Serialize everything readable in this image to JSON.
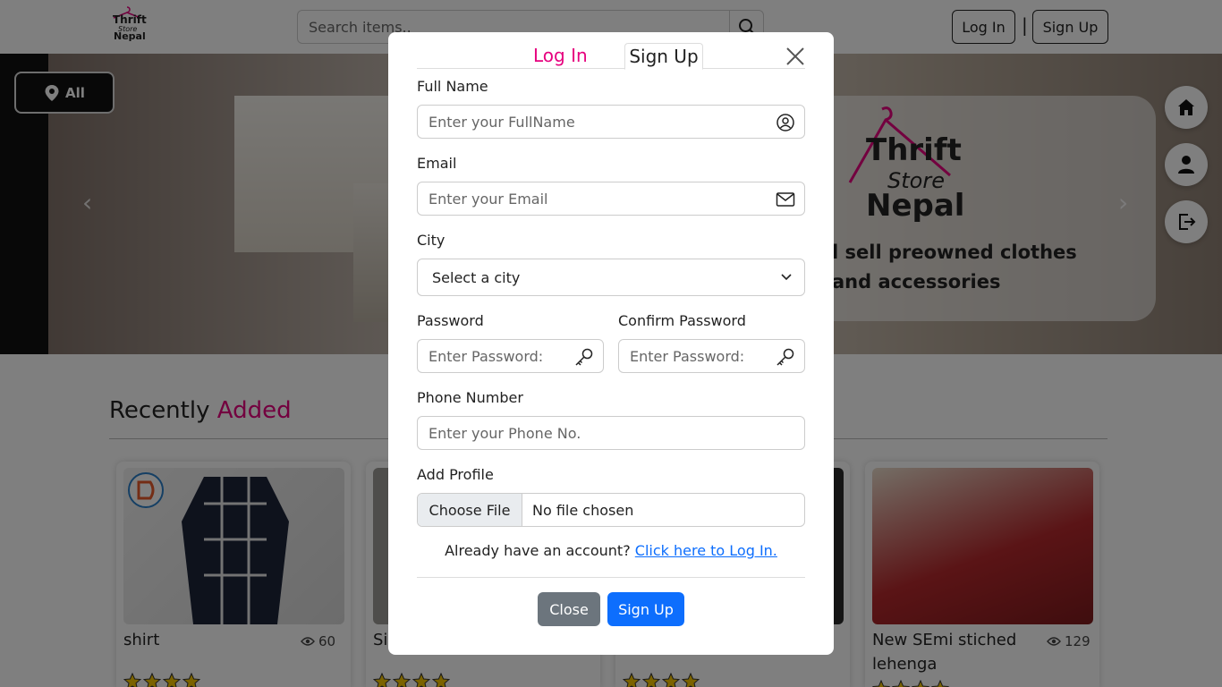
{
  "header": {
    "logo": {
      "line1": "Thrift",
      "line2": "Store",
      "line3": "Nepal"
    },
    "search_placeholder": "Search items..",
    "login_label": "Log In",
    "separator": "|",
    "signup_label": "Sign Up"
  },
  "hero": {
    "location_label": "All",
    "brand_line1": "Thrift",
    "brand_line2": "Store",
    "brand_line3": "Nepal",
    "tagline_line1": "l sell preowned clothes",
    "tagline_line2": "and accessories"
  },
  "recent": {
    "title_plain": "Recently",
    "title_accent": "Added",
    "products": [
      {
        "name": "shirt",
        "views": "60"
      },
      {
        "name": "Si"
      },
      {
        "name": ""
      },
      {
        "name": "New SEmi stiched lehenga",
        "views": "129"
      }
    ]
  },
  "modal": {
    "tab_login": "Log In",
    "tab_signup": "Sign Up",
    "fullname_label": "Full Name",
    "fullname_placeholder": "Enter your FullName",
    "email_label": "Email",
    "email_placeholder": "Enter your Email",
    "city_label": "City",
    "city_value": "Select a city",
    "password_label": "Password",
    "password_placeholder": "Enter Password:",
    "confirm_label": "Confirm Password",
    "confirm_placeholder": "Enter Password:",
    "phone_label": "Phone Number",
    "phone_placeholder": "Enter your Phone No.",
    "profile_label": "Add Profile",
    "choose_file": "Choose File",
    "no_file": "No file chosen",
    "already_text": "Already have an account?",
    "login_link": "Click here to Log In.",
    "close_button": "Close",
    "signup_button": "Sign Up"
  },
  "colors": {
    "accent": "#e6007e",
    "primary": "#0d6efd",
    "secondary": "#6c757d"
  }
}
